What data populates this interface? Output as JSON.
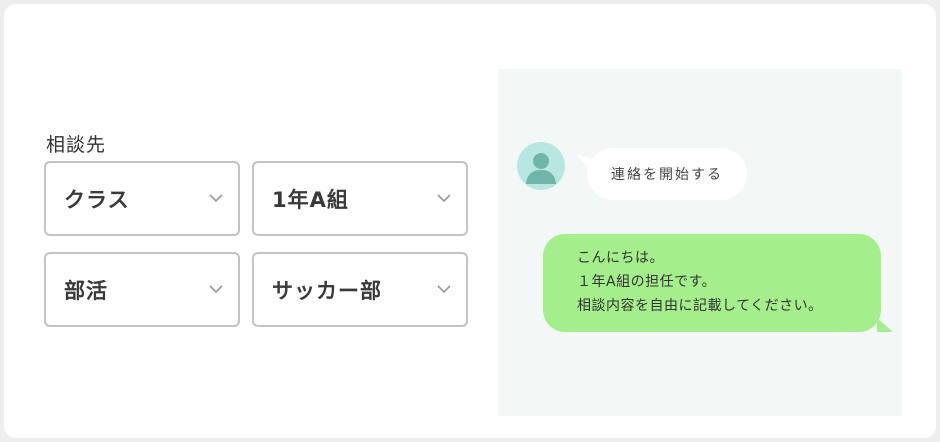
{
  "form": {
    "label": "相談先",
    "selects": [
      {
        "value": "クラス"
      },
      {
        "value": "1年A組"
      },
      {
        "value": "部活"
      },
      {
        "value": "サッカー部"
      }
    ]
  },
  "chat": {
    "incoming": "連絡を開始する",
    "outgoing_lines": [
      "こんにちは。",
      "１年A組の担任です。",
      "相談内容を自由に記載してください。"
    ]
  },
  "colors": {
    "outgoing_bubble": "#a5ee8c",
    "avatar_bg": "#b8e6e1",
    "avatar_figure": "#6fb5a8",
    "chat_bg": "#f3f7f6"
  },
  "icons": {
    "avatar": "user-avatar-icon",
    "select_arrow": "chevron-down-icon"
  }
}
